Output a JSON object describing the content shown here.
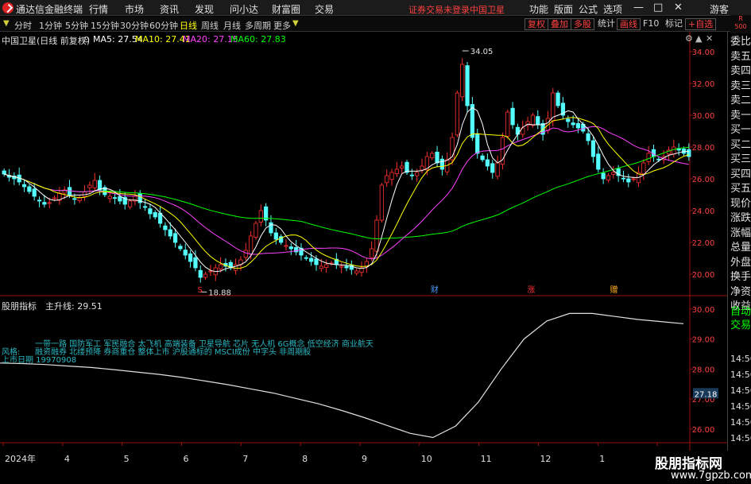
{
  "app": {
    "name": "通达信金融终端",
    "menu": [
      "行情",
      "市场",
      "资讯",
      "发现",
      "问小达",
      "财富圈",
      "交易"
    ],
    "login_warning": "证券交易未登录",
    "stock_name": "中国卫星",
    "right_menu": [
      "功能",
      "版面",
      "公式",
      "选项"
    ],
    "guest": "游客",
    "badge_top": "R",
    "badge_bottom": "500"
  },
  "periods": [
    "分时",
    "1分钟",
    "5分钟",
    "15分钟",
    "30分钟",
    "60分钟",
    "日线",
    "周线",
    "月线",
    "多周期",
    "更多"
  ],
  "active_period": "日线",
  "tools": [
    "复权",
    "叠加",
    "多股",
    "统计",
    "画线",
    "F10",
    "标记",
    "+自选"
  ],
  "main": {
    "title": "中国卫星(日线 前复权)",
    "ma5_label": "MA5: 27.54",
    "ma10_label": "MA10: 27.41",
    "ma20_label": "MA20: 27.15",
    "ma60_label": "MA60: 27.83",
    "high_label": "34.05",
    "low_label": "18.88",
    "marker_s": "S",
    "marker_cai": "财",
    "marker_zhang": "涨",
    "marker_zeng": "赠",
    "y_ticks": [
      "34.00",
      "32.00",
      "30.00",
      "28.00",
      "26.00",
      "24.00",
      "22.00",
      "20.00"
    ]
  },
  "indicator": {
    "name": "股朋指标",
    "line_label": "主升线: 29.51",
    "concept_line1": "一带一路 国防军工 军民融合 太飞机 高端装备 卫星导航 芯片 无人机 6G概念 低空经济 商业航天",
    "style_label": "风格:",
    "concept_line2": "融资融券 北缕预降 券商重仓 整体上市 沪股通标的 MSCI成份 中字头 非周期股",
    "listing_date": "上市日期 19970908",
    "y_ticks": [
      "30.00",
      "29.00",
      "28.00",
      "27.00",
      "26.00"
    ],
    "current_value": "27.18"
  },
  "x_axis": [
    "2024年",
    "4",
    "5",
    "6",
    "7",
    "8",
    "9",
    "10",
    "11",
    "12",
    "1",
    "2"
  ],
  "right_panel": {
    "items": [
      "委比",
      "卖五",
      "卖四",
      "卖三",
      "卖二",
      "卖一",
      "买一",
      "买二",
      "买三",
      "买四",
      "买五",
      "现价",
      "涨跌",
      "涨幅",
      "总量",
      "外盘",
      "换手",
      "净资",
      "收益"
    ],
    "auto_trade": [
      "自动",
      "交易"
    ],
    "times": [
      "14:56",
      "14:56",
      "14:56",
      "14:56",
      "14:56",
      "14:56",
      "14:56",
      "14:56"
    ]
  },
  "watermark": {
    "line1": "股朋指标网",
    "line2": "www.7gpzb.com"
  },
  "colors": {
    "up": "#ff3030",
    "down": "#54ffff",
    "ma5": "#ffffff",
    "ma10": "#ffff00",
    "ma20": "#ff40ff",
    "ma60": "#00ff00",
    "indicator_line": "#e0e0e0",
    "concept_text": "#2ab7c2"
  },
  "chart_data": {
    "type": "candlestick",
    "price_range": [
      19.0,
      34.5
    ],
    "indicator_range": [
      25.6,
      30.1
    ],
    "closes": [
      26.3,
      26.1,
      26.0,
      25.8,
      25.5,
      25.2,
      24.9,
      24.6,
      24.4,
      24.5,
      24.8,
      25.1,
      25.3,
      25.0,
      24.7,
      24.8,
      25.2,
      25.6,
      25.9,
      25.3,
      25.0,
      24.9,
      24.8,
      24.6,
      24.4,
      24.6,
      24.9,
      24.5,
      24.2,
      23.8,
      23.6,
      23.2,
      22.8,
      22.4,
      22.0,
      21.6,
      21.2,
      20.8,
      20.4,
      19.8,
      20.0,
      20.2,
      20.4,
      20.6,
      20.5,
      20.4,
      20.6,
      20.9,
      21.5,
      22.4,
      23.2,
      24.0,
      23.4,
      22.6,
      22.2,
      22.0,
      21.8,
      21.6,
      21.4,
      21.2,
      21.0,
      20.8,
      20.6,
      20.5,
      20.6,
      20.7,
      20.6,
      20.5,
      20.4,
      20.3,
      20.2,
      20.4,
      20.8,
      21.6,
      23.4,
      25.6,
      26.2,
      26.4,
      26.6,
      26.8,
      26.4,
      26.2,
      26.4,
      26.8,
      27.4,
      27.6,
      27.0,
      26.6,
      27.2,
      28.6,
      31.4,
      33.2,
      30.6,
      28.6,
      27.6,
      27.2,
      26.8,
      26.4,
      27.0,
      28.6,
      30.2,
      29.4,
      28.8,
      29.2,
      29.6,
      30.0,
      29.4,
      28.8,
      29.8,
      31.4,
      30.6,
      30.0,
      29.6,
      29.4,
      29.2,
      29.0,
      28.4,
      27.4,
      26.6,
      26.0,
      26.2,
      26.4,
      26.2,
      26.0,
      25.8,
      26.0,
      26.4,
      27.0,
      27.6,
      27.4,
      27.2,
      27.4,
      27.8,
      28.0,
      27.8,
      27.6,
      27.4
    ],
    "indicator": [
      28.2,
      28.18,
      28.15,
      28.1,
      28.05,
      27.98,
      27.9,
      27.82,
      27.72,
      27.6,
      27.48,
      27.34,
      27.2,
      27.02,
      26.84,
      26.62,
      26.38,
      26.12,
      25.86,
      25.72,
      26.1,
      26.9,
      28.0,
      29.0,
      29.6,
      29.85,
      29.85,
      29.75,
      29.65,
      29.58,
      29.51
    ],
    "ma": [
      "MA5",
      "MA10",
      "MA20",
      "MA60"
    ]
  }
}
